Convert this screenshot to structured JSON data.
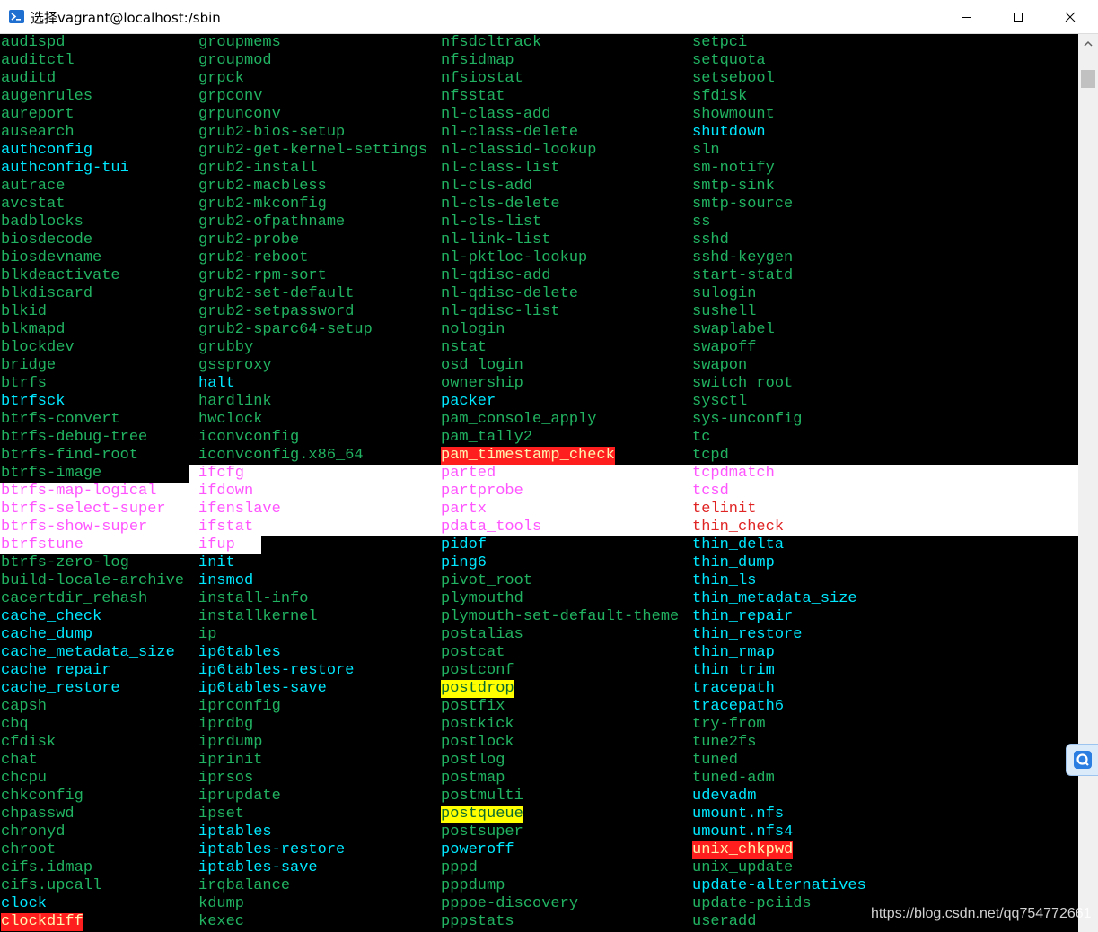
{
  "window": {
    "title": "选择vagrant@localhost:/sbin",
    "icon": "powershell-icon",
    "controls": [
      "minimize-icon",
      "maximize-icon",
      "close-icon"
    ]
  },
  "terminal": {
    "background": "#000000",
    "colors": {
      "green": "#21b361",
      "cyan": "#00e8ff",
      "magenta": "#ff55ff",
      "red": "#e02424",
      "highlight_red": "#ff1e1e",
      "highlight_yellow": "#ffff00"
    },
    "columns": [
      [
        {
          "text": "audispd",
          "style": "green"
        },
        {
          "text": "auditctl",
          "style": "green"
        },
        {
          "text": "auditd",
          "style": "green"
        },
        {
          "text": "augenrules",
          "style": "green"
        },
        {
          "text": "aureport",
          "style": "green"
        },
        {
          "text": "ausearch",
          "style": "green"
        },
        {
          "text": "authconfig",
          "style": "cyan"
        },
        {
          "text": "authconfig-tui",
          "style": "cyan"
        },
        {
          "text": "autrace",
          "style": "green"
        },
        {
          "text": "avcstat",
          "style": "green"
        },
        {
          "text": "badblocks",
          "style": "green"
        },
        {
          "text": "biosdecode",
          "style": "green"
        },
        {
          "text": "biosdevname",
          "style": "green"
        },
        {
          "text": "blkdeactivate",
          "style": "green"
        },
        {
          "text": "blkdiscard",
          "style": "green"
        },
        {
          "text": "blkid",
          "style": "green"
        },
        {
          "text": "blkmapd",
          "style": "green"
        },
        {
          "text": "blockdev",
          "style": "green"
        },
        {
          "text": "bridge",
          "style": "green"
        },
        {
          "text": "btrfs",
          "style": "green"
        },
        {
          "text": "btrfsck",
          "style": "cyan"
        },
        {
          "text": "btrfs-convert",
          "style": "green"
        },
        {
          "text": "btrfs-debug-tree",
          "style": "green"
        },
        {
          "text": "btrfs-find-root",
          "style": "green"
        },
        {
          "text": "btrfs-image",
          "style": "green"
        },
        {
          "text": "btrfs-map-logical",
          "style": "magenta"
        },
        {
          "text": "btrfs-select-super",
          "style": "magenta"
        },
        {
          "text": "btrfs-show-super",
          "style": "magenta"
        },
        {
          "text": "btrfstune",
          "style": "magenta"
        },
        {
          "text": "btrfs-zero-log",
          "style": "green"
        },
        {
          "text": "build-locale-archive",
          "style": "green"
        },
        {
          "text": "cacertdir_rehash",
          "style": "green"
        },
        {
          "text": "cache_check",
          "style": "cyan"
        },
        {
          "text": "cache_dump",
          "style": "cyan"
        },
        {
          "text": "cache_metadata_size",
          "style": "cyan"
        },
        {
          "text": "cache_repair",
          "style": "cyan"
        },
        {
          "text": "cache_restore",
          "style": "cyan"
        },
        {
          "text": "capsh",
          "style": "green"
        },
        {
          "text": "cbq",
          "style": "green"
        },
        {
          "text": "cfdisk",
          "style": "green"
        },
        {
          "text": "chat",
          "style": "green"
        },
        {
          "text": "chcpu",
          "style": "green"
        },
        {
          "text": "chkconfig",
          "style": "green"
        },
        {
          "text": "chpasswd",
          "style": "green"
        },
        {
          "text": "chronyd",
          "style": "green"
        },
        {
          "text": "chroot",
          "style": "green"
        },
        {
          "text": "cifs.idmap",
          "style": "green"
        },
        {
          "text": "cifs.upcall",
          "style": "green"
        },
        {
          "text": "clock",
          "style": "cyan"
        },
        {
          "text": "clockdiff",
          "style": "hl-red"
        }
      ],
      [
        {
          "text": "groupmems",
          "style": "green"
        },
        {
          "text": "groupmod",
          "style": "green"
        },
        {
          "text": "grpck",
          "style": "green"
        },
        {
          "text": "grpconv",
          "style": "green"
        },
        {
          "text": "grpunconv",
          "style": "green"
        },
        {
          "text": "grub2-bios-setup",
          "style": "green"
        },
        {
          "text": "grub2-get-kernel-settings",
          "style": "green"
        },
        {
          "text": "grub2-install",
          "style": "green"
        },
        {
          "text": "grub2-macbless",
          "style": "green"
        },
        {
          "text": "grub2-mkconfig",
          "style": "green"
        },
        {
          "text": "grub2-ofpathname",
          "style": "green"
        },
        {
          "text": "grub2-probe",
          "style": "green"
        },
        {
          "text": "grub2-reboot",
          "style": "green"
        },
        {
          "text": "grub2-rpm-sort",
          "style": "green"
        },
        {
          "text": "grub2-set-default",
          "style": "green"
        },
        {
          "text": "grub2-setpassword",
          "style": "green"
        },
        {
          "text": "grub2-sparc64-setup",
          "style": "green"
        },
        {
          "text": "grubby",
          "style": "green"
        },
        {
          "text": "gssproxy",
          "style": "green"
        },
        {
          "text": "halt",
          "style": "cyan"
        },
        {
          "text": "hardlink",
          "style": "green"
        },
        {
          "text": "hwclock",
          "style": "green"
        },
        {
          "text": "iconvconfig",
          "style": "green"
        },
        {
          "text": "iconvconfig.x86_64",
          "style": "green"
        },
        {
          "text": "ifcfg",
          "style": "magenta"
        },
        {
          "text": "ifdown",
          "style": "magenta"
        },
        {
          "text": "ifenslave",
          "style": "magenta"
        },
        {
          "text": "ifstat",
          "style": "magenta"
        },
        {
          "text": "ifup",
          "style": "magenta"
        },
        {
          "text": "init",
          "style": "cyan"
        },
        {
          "text": "insmod",
          "style": "cyan"
        },
        {
          "text": "install-info",
          "style": "green"
        },
        {
          "text": "installkernel",
          "style": "green"
        },
        {
          "text": "ip",
          "style": "green"
        },
        {
          "text": "ip6tables",
          "style": "cyan"
        },
        {
          "text": "ip6tables-restore",
          "style": "cyan"
        },
        {
          "text": "ip6tables-save",
          "style": "cyan"
        },
        {
          "text": "iprconfig",
          "style": "green"
        },
        {
          "text": "iprdbg",
          "style": "green"
        },
        {
          "text": "iprdump",
          "style": "green"
        },
        {
          "text": "iprinit",
          "style": "green"
        },
        {
          "text": "iprsos",
          "style": "green"
        },
        {
          "text": "iprupdate",
          "style": "green"
        },
        {
          "text": "ipset",
          "style": "green"
        },
        {
          "text": "iptables",
          "style": "cyan"
        },
        {
          "text": "iptables-restore",
          "style": "cyan"
        },
        {
          "text": "iptables-save",
          "style": "cyan"
        },
        {
          "text": "irqbalance",
          "style": "green"
        },
        {
          "text": "kdump",
          "style": "green"
        },
        {
          "text": "kexec",
          "style": "green"
        }
      ],
      [
        {
          "text": "nfsdcltrack",
          "style": "green"
        },
        {
          "text": "nfsidmap",
          "style": "green"
        },
        {
          "text": "nfsiostat",
          "style": "green"
        },
        {
          "text": "nfsstat",
          "style": "green"
        },
        {
          "text": "nl-class-add",
          "style": "green"
        },
        {
          "text": "nl-class-delete",
          "style": "green"
        },
        {
          "text": "nl-classid-lookup",
          "style": "green"
        },
        {
          "text": "nl-class-list",
          "style": "green"
        },
        {
          "text": "nl-cls-add",
          "style": "green"
        },
        {
          "text": "nl-cls-delete",
          "style": "green"
        },
        {
          "text": "nl-cls-list",
          "style": "green"
        },
        {
          "text": "nl-link-list",
          "style": "green"
        },
        {
          "text": "nl-pktloc-lookup",
          "style": "green"
        },
        {
          "text": "nl-qdisc-add",
          "style": "green"
        },
        {
          "text": "nl-qdisc-delete",
          "style": "green"
        },
        {
          "text": "nl-qdisc-list",
          "style": "green"
        },
        {
          "text": "nologin",
          "style": "green"
        },
        {
          "text": "nstat",
          "style": "green"
        },
        {
          "text": "osd_login",
          "style": "green"
        },
        {
          "text": "ownership",
          "style": "green"
        },
        {
          "text": "packer",
          "style": "cyan"
        },
        {
          "text": "pam_console_apply",
          "style": "green"
        },
        {
          "text": "pam_tally2",
          "style": "green"
        },
        {
          "text": "pam_timestamp_check",
          "style": "hl-red"
        },
        {
          "text": "parted",
          "style": "magenta"
        },
        {
          "text": "partprobe",
          "style": "magenta"
        },
        {
          "text": "partx",
          "style": "magenta"
        },
        {
          "text": "pdata_tools",
          "style": "magenta"
        },
        {
          "text": "pidof",
          "style": "cyan"
        },
        {
          "text": "ping6",
          "style": "cyan"
        },
        {
          "text": "pivot_root",
          "style": "green"
        },
        {
          "text": "plymouthd",
          "style": "green"
        },
        {
          "text": "plymouth-set-default-theme",
          "style": "green"
        },
        {
          "text": "postalias",
          "style": "green"
        },
        {
          "text": "postcat",
          "style": "green"
        },
        {
          "text": "postconf",
          "style": "green"
        },
        {
          "text": "postdrop",
          "style": "hl-yellow"
        },
        {
          "text": "postfix",
          "style": "green"
        },
        {
          "text": "postkick",
          "style": "green"
        },
        {
          "text": "postlock",
          "style": "green"
        },
        {
          "text": "postlog",
          "style": "green"
        },
        {
          "text": "postmap",
          "style": "green"
        },
        {
          "text": "postmulti",
          "style": "green"
        },
        {
          "text": "postqueue",
          "style": "hl-yellow"
        },
        {
          "text": "postsuper",
          "style": "green"
        },
        {
          "text": "poweroff",
          "style": "cyan"
        },
        {
          "text": "pppd",
          "style": "green"
        },
        {
          "text": "pppdump",
          "style": "green"
        },
        {
          "text": "pppoe-discovery",
          "style": "green"
        },
        {
          "text": "pppstats",
          "style": "green"
        }
      ],
      [
        {
          "text": "setpci",
          "style": "green"
        },
        {
          "text": "setquota",
          "style": "green"
        },
        {
          "text": "setsebool",
          "style": "green"
        },
        {
          "text": "sfdisk",
          "style": "green"
        },
        {
          "text": "showmount",
          "style": "green"
        },
        {
          "text": "shutdown",
          "style": "cyan"
        },
        {
          "text": "sln",
          "style": "green"
        },
        {
          "text": "sm-notify",
          "style": "green"
        },
        {
          "text": "smtp-sink",
          "style": "green"
        },
        {
          "text": "smtp-source",
          "style": "green"
        },
        {
          "text": "ss",
          "style": "green"
        },
        {
          "text": "sshd",
          "style": "green"
        },
        {
          "text": "sshd-keygen",
          "style": "green"
        },
        {
          "text": "start-statd",
          "style": "green"
        },
        {
          "text": "sulogin",
          "style": "green"
        },
        {
          "text": "sushell",
          "style": "green"
        },
        {
          "text": "swaplabel",
          "style": "green"
        },
        {
          "text": "swapoff",
          "style": "green"
        },
        {
          "text": "swapon",
          "style": "green"
        },
        {
          "text": "switch_root",
          "style": "green"
        },
        {
          "text": "sysctl",
          "style": "green"
        },
        {
          "text": "sys-unconfig",
          "style": "green"
        },
        {
          "text": "tc",
          "style": "green"
        },
        {
          "text": "tcpd",
          "style": "green"
        },
        {
          "text": "tcpdmatch",
          "style": "magenta"
        },
        {
          "text": "tcsd",
          "style": "magenta"
        },
        {
          "text": "telinit",
          "style": "red"
        },
        {
          "text": "thin_check",
          "style": "red"
        },
        {
          "text": "thin_delta",
          "style": "cyan"
        },
        {
          "text": "thin_dump",
          "style": "cyan"
        },
        {
          "text": "thin_ls",
          "style": "cyan"
        },
        {
          "text": "thin_metadata_size",
          "style": "cyan"
        },
        {
          "text": "thin_repair",
          "style": "cyan"
        },
        {
          "text": "thin_restore",
          "style": "cyan"
        },
        {
          "text": "thin_rmap",
          "style": "cyan"
        },
        {
          "text": "thin_trim",
          "style": "cyan"
        },
        {
          "text": "tracepath",
          "style": "cyan"
        },
        {
          "text": "tracepath6",
          "style": "cyan"
        },
        {
          "text": "try-from",
          "style": "green"
        },
        {
          "text": "tune2fs",
          "style": "green"
        },
        {
          "text": "tuned",
          "style": "green"
        },
        {
          "text": "tuned-adm",
          "style": "green"
        },
        {
          "text": "udevadm",
          "style": "cyan"
        },
        {
          "text": "umount.nfs",
          "style": "cyan"
        },
        {
          "text": "umount.nfs4",
          "style": "cyan"
        },
        {
          "text": "unix_chkpwd",
          "style": "hl-red"
        },
        {
          "text": "unix_update",
          "style": "green"
        },
        {
          "text": "update-alternatives",
          "style": "cyan"
        },
        {
          "text": "update-pciids",
          "style": "green"
        },
        {
          "text": "useradd",
          "style": "green"
        }
      ]
    ]
  },
  "watermark": "https://blog.csdn.net/qq754772661"
}
